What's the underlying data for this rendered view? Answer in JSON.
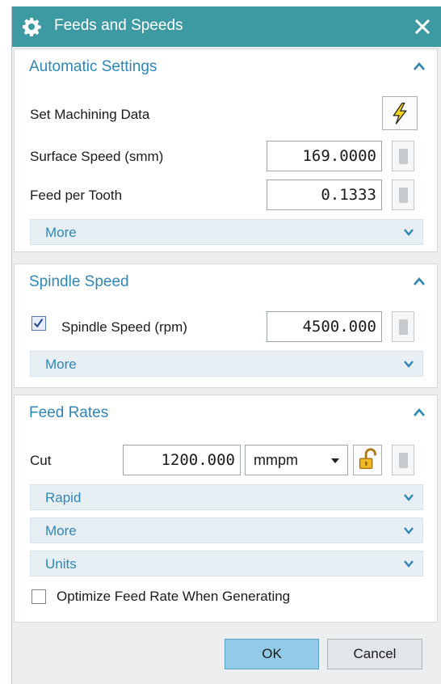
{
  "dialog": {
    "title": "Feeds and Speeds",
    "title_icon": "gear-icon",
    "close_icon": "close-icon"
  },
  "automatic_settings": {
    "title": "Automatic Settings",
    "set_machining_data_label": "Set Machining Data",
    "set_machining_data_icon": "lightning-icon",
    "surface_speed_label": "Surface Speed (smm)",
    "surface_speed_value": "169.0000",
    "feed_per_tooth_label": "Feed per Tooth",
    "feed_per_tooth_value": "0.1333",
    "more_label": "More"
  },
  "spindle_speed": {
    "title": "Spindle Speed",
    "checkbox_checked": true,
    "spindle_speed_label": "Spindle Speed (rpm)",
    "spindle_speed_value": "4500.000",
    "more_label": "More"
  },
  "feed_rates": {
    "title": "Feed Rates",
    "cut_label": "Cut",
    "cut_value": "1200.000",
    "cut_unit": "mmpm",
    "cut_lock_icon": "unlock-icon",
    "rapid_label": "Rapid",
    "more_label": "More",
    "units_label": "Units",
    "optimize_label": "Optimize Feed Rate When Generating",
    "optimize_checked": false
  },
  "buttons": {
    "ok_label": "OK",
    "cancel_label": "Cancel"
  },
  "colors": {
    "titlebar": "#3d9aa3",
    "section_title": "#2f86b5",
    "ok_button": "#92cbe8"
  }
}
